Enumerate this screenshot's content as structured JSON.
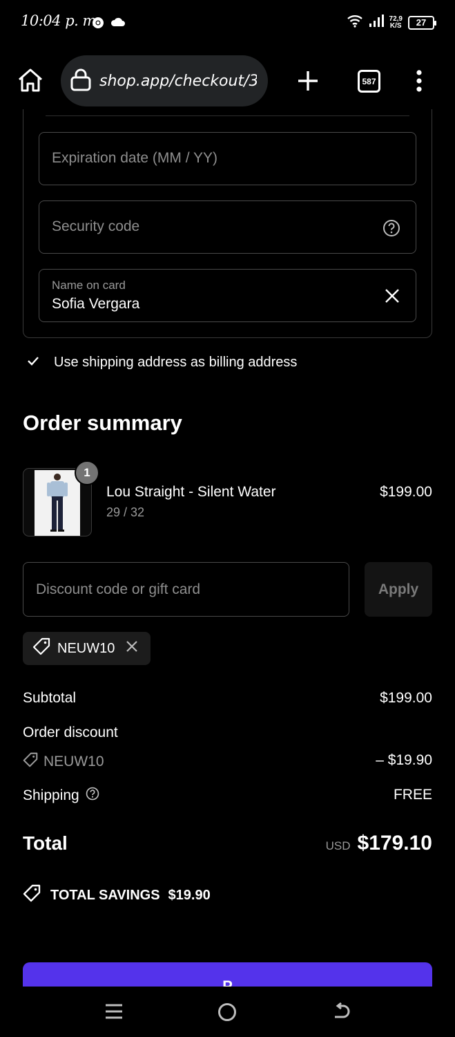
{
  "status_bar": {
    "time": "10:04 p. m.",
    "net_speed_value": "72,9",
    "net_speed_unit": "K/S",
    "battery": "27"
  },
  "browser": {
    "url": "shop.app/checkout/3",
    "tabs_count": "587"
  },
  "payment_form": {
    "expiration_placeholder": "Expiration date (MM / YY)",
    "security_placeholder": "Security code",
    "name_label": "Name on card",
    "name_value": "Sofia Vergara"
  },
  "billing": {
    "label": "Use shipping address as billing address",
    "checked": true
  },
  "order_summary": {
    "heading": "Order summary",
    "item": {
      "name": "Lou Straight - Silent Water",
      "variant": "29 / 32",
      "price": "$199.00",
      "quantity": "1"
    },
    "discount_placeholder": "Discount code or gift card",
    "apply_label": "Apply",
    "applied_code": "NEUW10",
    "subtotal_label": "Subtotal",
    "subtotal_value": "$199.00",
    "order_discount_label": "Order discount",
    "discount_code": "NEUW10",
    "discount_value": "– $19.90",
    "shipping_label": "Shipping",
    "shipping_value": "FREE",
    "total_label": "Total",
    "total_currency": "USD",
    "total_value": "$179.10",
    "savings_label": "TOTAL SAVINGS",
    "savings_value": "$19.90"
  },
  "pay_button": {
    "label": "P",
    "color": "#5433eb"
  }
}
